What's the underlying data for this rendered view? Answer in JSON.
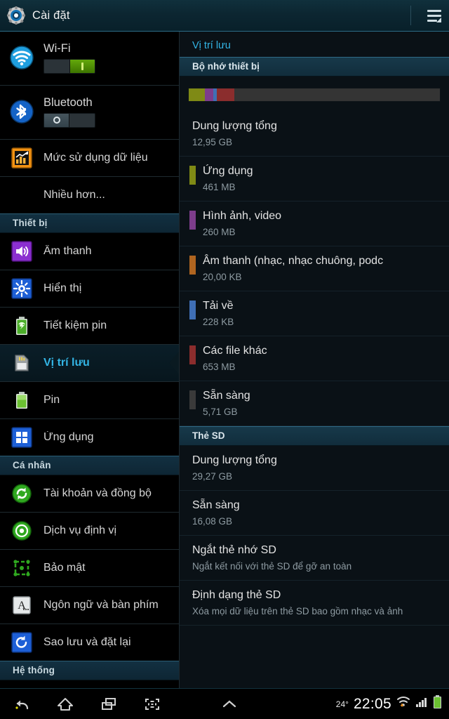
{
  "actionbar": {
    "title": "Cài đặt",
    "gear_icon": "gear-icon",
    "menu_icon": "overflow-list-icon"
  },
  "sidebar": {
    "toggles": [
      {
        "label": "Wi-Fi",
        "icon": "wifi-icon",
        "state": "on"
      },
      {
        "label": "Bluetooth",
        "icon": "bluetooth-icon",
        "state": "off"
      }
    ],
    "quick_items": [
      {
        "label": "Mức sử dụng dữ liệu",
        "icon": "data-usage-icon"
      },
      {
        "label": "Nhiều hơn...",
        "icon": ""
      }
    ],
    "sections": [
      {
        "header": "Thiết bị",
        "items": [
          {
            "label": "Âm thanh",
            "icon": "speaker-icon",
            "selected": false
          },
          {
            "label": "Hiển thị",
            "icon": "brightness-icon",
            "selected": false
          },
          {
            "label": "Tiết kiệm pin",
            "icon": "power-saving-icon",
            "selected": false
          },
          {
            "label": "Vị trí lưu",
            "icon": "storage-card-icon",
            "selected": true
          },
          {
            "label": "Pin",
            "icon": "battery-icon",
            "selected": false
          },
          {
            "label": "Ứng dụng",
            "icon": "apps-grid-icon",
            "selected": false
          }
        ]
      },
      {
        "header": "Cá nhân",
        "items": [
          {
            "label": "Tài khoản và đồng bộ",
            "icon": "sync-icon",
            "selected": false
          },
          {
            "label": "Dịch vụ định vị",
            "icon": "location-icon",
            "selected": false
          },
          {
            "label": "Bảo mật",
            "icon": "security-icon",
            "selected": false
          },
          {
            "label": "Ngôn ngữ và bàn phím",
            "icon": "language-keyboard-icon",
            "selected": false
          },
          {
            "label": "Sao lưu và đặt lại",
            "icon": "backup-reset-icon",
            "selected": false
          }
        ]
      },
      {
        "header": "Hệ thống",
        "items": []
      }
    ]
  },
  "pane": {
    "title": "Vị trí lưu",
    "device_storage": {
      "header": "Bộ nhớ thiết bị",
      "bar_segments": [
        {
          "name": "Ứng dụng",
          "color": "#7f8a15",
          "percent": 6.5
        },
        {
          "name": "Hình ảnh, video",
          "color": "#7d3d8c",
          "percent": 3.2
        },
        {
          "name": "Tải về",
          "color": "#3f6fb5",
          "percent": 1.4
        },
        {
          "name": "Các file khác",
          "color": "#8b2d2d",
          "percent": 7.0
        },
        {
          "name": "Sẵn sàng",
          "color": "#343434",
          "percent": 81.9
        }
      ],
      "rows": [
        {
          "title": "Dung lượng tổng",
          "value": "12,95 GB",
          "color": ""
        },
        {
          "title": "Ứng dụng",
          "value": "461 MB",
          "color": "#7f8a15"
        },
        {
          "title": "Hình ảnh, video",
          "value": "260 MB",
          "color": "#7d3d8c"
        },
        {
          "title": "Âm thanh (nhạc, nhạc chuông, podc",
          "value": "20,00 KB",
          "color": "#b06520"
        },
        {
          "title": "Tải về",
          "value": "228 KB",
          "color": "#3f6fb5"
        },
        {
          "title": "Các file khác",
          "value": "653 MB",
          "color": "#8b2d2d"
        },
        {
          "title": "Sẵn sàng",
          "value": "5,71 GB",
          "color": "#3a3a3a"
        }
      ]
    },
    "sd_card": {
      "header": "Thẻ SD",
      "rows": [
        {
          "title": "Dung lượng tổng",
          "value": "29,27 GB"
        },
        {
          "title": "Sẵn sàng",
          "value": "16,08 GB"
        },
        {
          "title": "Ngắt thẻ nhớ SD",
          "value": "Ngắt kết nối với thẻ SD để gỡ an toàn"
        },
        {
          "title": "Định dạng thẻ SD",
          "value": "Xóa mọi dữ liệu trên thẻ SD bao gồm nhạc và ảnh"
        }
      ]
    }
  },
  "systembar": {
    "buttons": [
      {
        "name": "back-icon"
      },
      {
        "name": "home-icon"
      },
      {
        "name": "recent-apps-icon"
      },
      {
        "name": "screenshot-icon"
      },
      {
        "name": "chevron-up-icon"
      }
    ],
    "temperature": "24°",
    "clock": "22:05",
    "status_icons": [
      "wifi-status-icon",
      "signal-icon",
      "battery-status-icon"
    ]
  }
}
